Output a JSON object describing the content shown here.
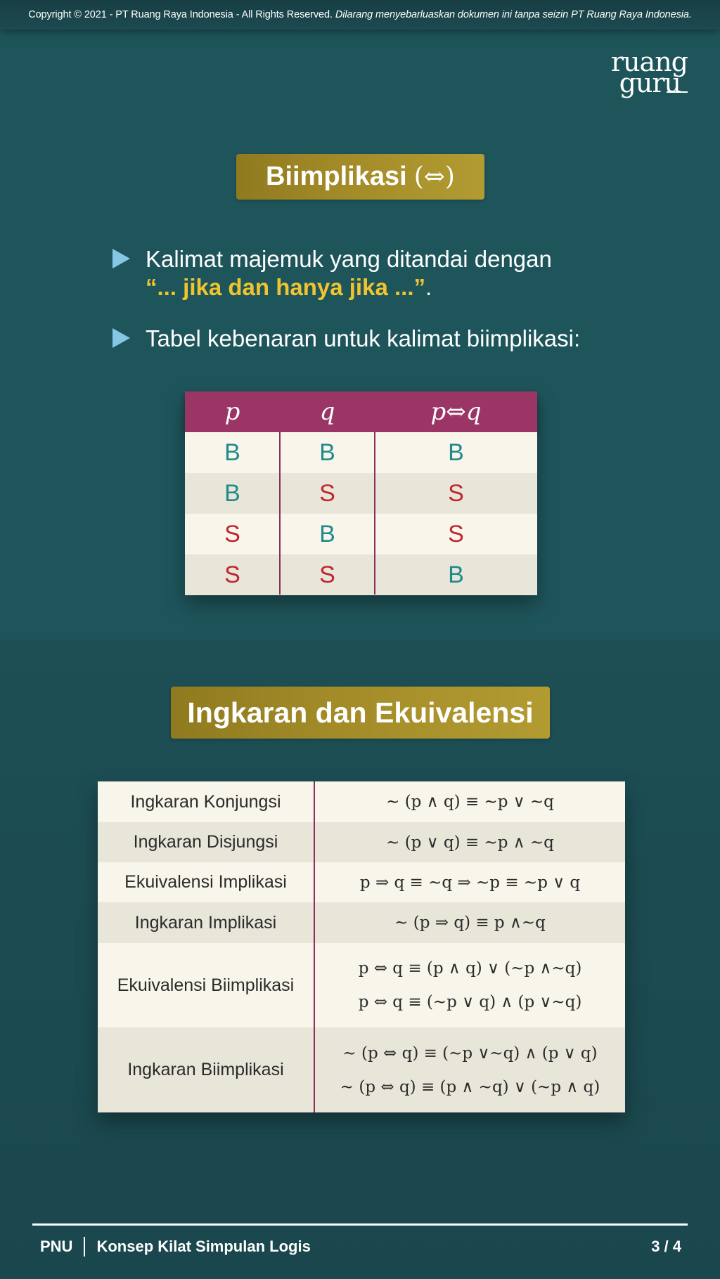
{
  "copyright": {
    "main": "Copyright © 2021 - PT Ruang Raya Indonesia - All Rights Reserved.",
    "notice": "Dilarang menyebarluaskan dokumen ini tanpa seizin PT Ruang Raya Indonesia."
  },
  "logo": {
    "line1": "ruang",
    "line2": "guru"
  },
  "section1": {
    "title": "Biimplikasi",
    "title_symbol": "(⇔)",
    "bullet1_line1": "Kalimat majemuk yang ditandai dengan",
    "bullet1_highlight": "“... jika dan hanya jika ...”",
    "bullet1_end": ".",
    "bullet2": "Tabel kebenaran untuk kalimat biimplikasi:"
  },
  "truth_table": {
    "headers": [
      "p",
      "q",
      "p⇔q"
    ],
    "rows": [
      [
        "B",
        "B",
        "B"
      ],
      [
        "B",
        "S",
        "S"
      ],
      [
        "S",
        "B",
        "S"
      ],
      [
        "S",
        "S",
        "B"
      ]
    ]
  },
  "section2": {
    "title": "Ingkaran dan Ekuivalensi"
  },
  "equivalence_table": {
    "rows": [
      {
        "name": "Ingkaran Konjungsi",
        "formulas": [
          "∼ (p ∧ q) ≡ ∼p ∨ ∼q"
        ]
      },
      {
        "name": "Ingkaran Disjungsi",
        "formulas": [
          "∼ (p ∨ q) ≡ ∼p ∧ ∼q"
        ]
      },
      {
        "name": "Ekuivalensi Implikasi",
        "formulas": [
          "p ⇒ q ≡ ∼q ⇒ ∼p ≡ ∼p ∨ q"
        ]
      },
      {
        "name": "Ingkaran Implikasi",
        "formulas": [
          "∼ (p ⇒ q) ≡ p ∧∼q"
        ]
      },
      {
        "name": "Ekuivalensi Biimplikasi",
        "formulas": [
          "p ⇔ q ≡ (p ∧ q) ∨ (∼p ∧∼q)",
          "p ⇔ q ≡ (∼p ∨ q) ∧ (p ∨∼q)"
        ]
      },
      {
        "name": "Ingkaran Biimplikasi",
        "formulas": [
          "∼ (p ⇔ q) ≡ (∼p ∨∼q) ∧ (p ∨ q)",
          "∼ (p ⇔ q) ≡ (p ∧ ∼q) ∨ (∼p ∧ q)"
        ]
      }
    ]
  },
  "footer": {
    "code": "PNU",
    "title": "Konsep Kilat Simpulan Logis",
    "page": "3 / 4"
  },
  "colors": {
    "background": "#1e555b",
    "title_gold": "#a38c28",
    "highlight_yellow": "#f0c42e",
    "table_header": "#9b3566",
    "true_value": "#238a8c",
    "false_value": "#c0262e",
    "bullet_icon": "#86c7e6"
  }
}
